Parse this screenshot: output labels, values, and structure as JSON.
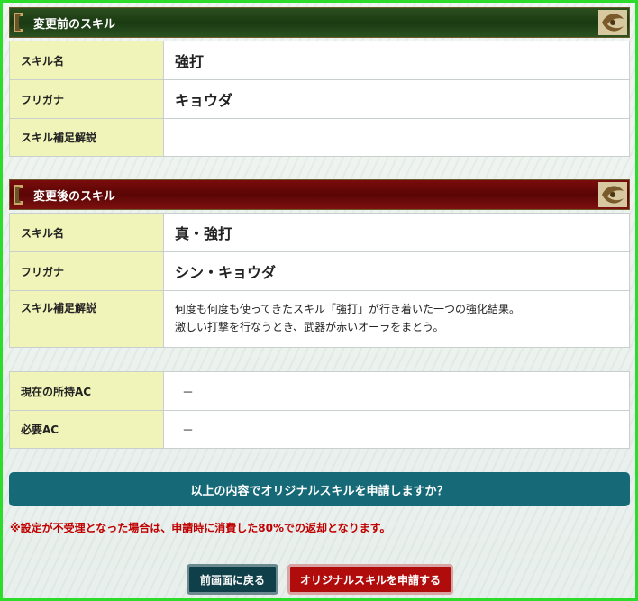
{
  "before": {
    "header": "変更前のスキル",
    "rows": [
      {
        "label": "スキル名",
        "value": "強打"
      },
      {
        "label": "フリガナ",
        "value": "キョウダ"
      },
      {
        "label": "スキル補足解説",
        "value": ""
      }
    ]
  },
  "after": {
    "header": "変更後のスキル",
    "rows": [
      {
        "label": "スキル名",
        "value": "真・強打"
      },
      {
        "label": "フリガナ",
        "value": "シン・キョウダ"
      },
      {
        "label": "スキル補足解説",
        "value_line1": "何度も何度も使ってきたスキル「強打」が行き着いた一つの強化結果。",
        "value_line2": "激しい打撃を行なうとき、武器が赤いオーラをまとう。"
      }
    ]
  },
  "ac": {
    "rows": [
      {
        "label": "現在の所持AC",
        "value": "－"
      },
      {
        "label": "必要AC",
        "value": "－"
      }
    ]
  },
  "confirm_text": "以上の内容でオリジナルスキルを申請しますか？",
  "notice": "※設定が不受理となった場合は、申請時に消費した80%での返却となります。",
  "buttons": {
    "back": "前画面に戻る",
    "submit": "オリジナルスキルを申請する"
  }
}
